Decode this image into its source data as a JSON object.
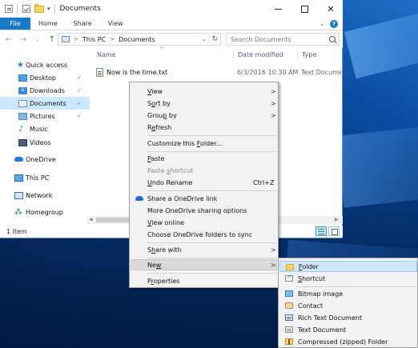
{
  "window": {
    "title": "Documents",
    "quick_access_dropdown": "▾",
    "minimize_glyph": "",
    "close_glyph": "✕"
  },
  "ribbon": {
    "tabs": [
      "File",
      "Home",
      "Share",
      "View"
    ],
    "expand_glyph": "⌄",
    "help_glyph": "?"
  },
  "nav": {
    "back_glyph": "←",
    "forward_glyph": "→",
    "recent_glyph": "⌄",
    "up_glyph": "↑",
    "address": [
      "This PC",
      "Documents"
    ],
    "address_separator": ">",
    "address_dropdown": "⌄",
    "refresh_glyph": "↻",
    "search_placeholder": "Search Documents"
  },
  "sidebar": {
    "items": [
      {
        "label": "Quick access",
        "icon": "star-icon",
        "pinned": false
      },
      {
        "label": "Desktop",
        "icon": "desktop-icon",
        "pinned": true
      },
      {
        "label": "Downloads",
        "icon": "downloads-icon",
        "pinned": true
      },
      {
        "label": "Documents",
        "icon": "documents-icon",
        "pinned": true,
        "selected": true
      },
      {
        "label": "Pictures",
        "icon": "pictures-icon",
        "pinned": true
      },
      {
        "label": "Music",
        "icon": "music-icon",
        "pinned": false
      },
      {
        "label": "Videos",
        "icon": "videos-icon",
        "pinned": false
      },
      {
        "label": "OneDrive",
        "icon": "onedrive-icon",
        "pinned": false
      },
      {
        "label": "This PC",
        "icon": "this-pc-icon",
        "pinned": false
      },
      {
        "label": "Network",
        "icon": "network-icon",
        "pinned": false
      },
      {
        "label": "Homegroup",
        "icon": "homegroup-icon",
        "pinned": false
      }
    ],
    "pin_glyph": "📌"
  },
  "content": {
    "columns": [
      "Name",
      "Date modified",
      "Type"
    ],
    "sort_glyph": "^",
    "files": [
      {
        "name": "Now is the time.txt",
        "date": "6/3/2016 10:30 AM",
        "type": "Text Document"
      }
    ]
  },
  "status": {
    "item_count": "1 item"
  },
  "context_menu": {
    "items": [
      {
        "label": "View",
        "underline": "V",
        "rest": "iew",
        "submenu": true
      },
      {
        "label": "Sort by",
        "underline": "o",
        "pre": "S",
        "rest": "rt by",
        "submenu": true
      },
      {
        "label": "Group by",
        "underline": "p",
        "pre": "Grou",
        "rest": " by",
        "submenu": true
      },
      {
        "label": "Refresh",
        "underline": "e",
        "pre": "R",
        "rest": "fresh"
      },
      {
        "label": "Customize this folder...",
        "underline": "F",
        "pre": "Customize this ",
        "rest": "older..."
      },
      {
        "label": "Paste",
        "underline": "P",
        "rest": "aste"
      },
      {
        "label": "Paste shortcut",
        "underline": "s",
        "pre": "Paste ",
        "rest": "hortcut",
        "disabled": true
      },
      {
        "label": "Undo Rename",
        "underline": "U",
        "rest": "ndo Rename",
        "shortcut": "Ctrl+Z"
      },
      {
        "label": "Share a OneDrive link"
      },
      {
        "label": "More OneDrive sharing options"
      },
      {
        "label": "View online",
        "underline": "V",
        "rest": "iew online"
      },
      {
        "label": "Choose OneDrive folders to sync"
      },
      {
        "label": "Share with",
        "underline": "h",
        "pre": "S",
        "rest": "are with",
        "submenu": true
      },
      {
        "label": "New",
        "underline": "w",
        "pre": "Ne",
        "rest": "",
        "submenu": true,
        "hover": true
      },
      {
        "label": "Properties",
        "underline": "r",
        "pre": "P",
        "rest": "operties"
      }
    ],
    "arrow_glyph": ">"
  },
  "new_submenu": {
    "items": [
      {
        "label": "Folder",
        "underline": "F",
        "rest": "older",
        "icon": "folder-icon"
      },
      {
        "label": "Shortcut",
        "underline": "S",
        "rest": "hortcut",
        "icon": "shortcut-icon"
      },
      {
        "label": "Bitmap image",
        "icon": "bitmap-icon"
      },
      {
        "label": "Contact",
        "icon": "contact-icon"
      },
      {
        "label": "Rich Text Document",
        "icon": "rich-text-icon"
      },
      {
        "label": "Text Document",
        "icon": "text-document-icon"
      },
      {
        "label": "Compressed (zipped) Folder",
        "icon": "zip-folder-icon"
      }
    ]
  }
}
